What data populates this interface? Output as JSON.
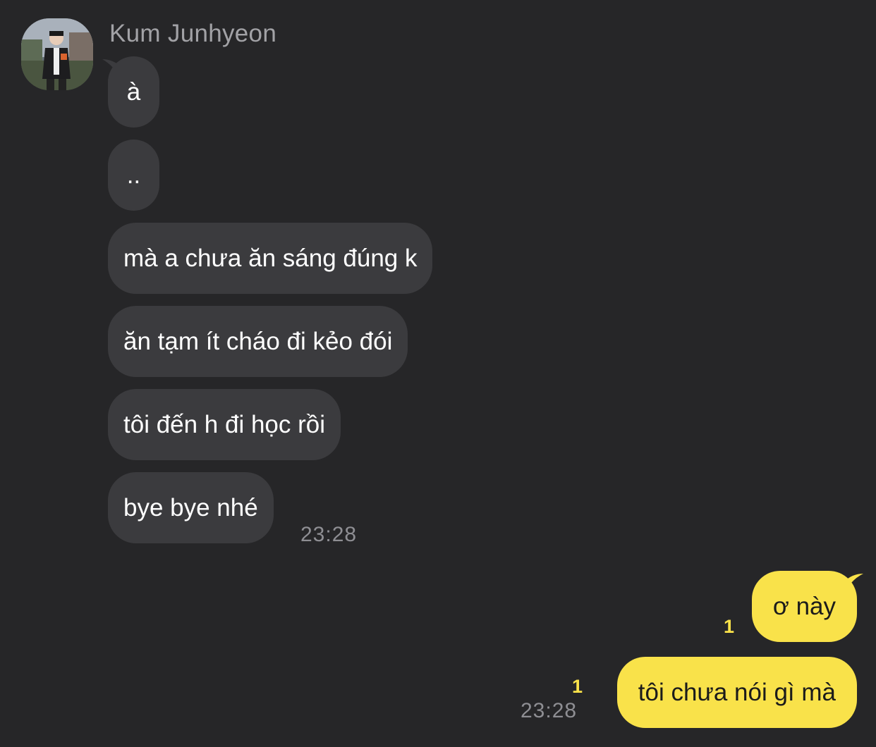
{
  "conversation": {
    "sender_name": "Kum Junhyeon",
    "incoming_messages": [
      "à",
      "..",
      "mà a chưa ăn sáng đúng k",
      "ăn tạm ít cháo đi kẻo đói",
      "tôi đến h đi học rồi",
      "bye bye nhé"
    ],
    "incoming_time": "23:28",
    "outgoing_messages": [
      {
        "text": "ơ này",
        "unread_count": "1"
      },
      {
        "text": "tôi chưa nói gì mà",
        "unread_count": "1"
      }
    ],
    "outgoing_time": "23:28"
  },
  "colors": {
    "background": "#262628",
    "incoming_bubble": "#3b3b3e",
    "outgoing_bubble": "#f9e24a",
    "unread_count": "#f9e24a",
    "timestamp": "#8e8e93"
  }
}
